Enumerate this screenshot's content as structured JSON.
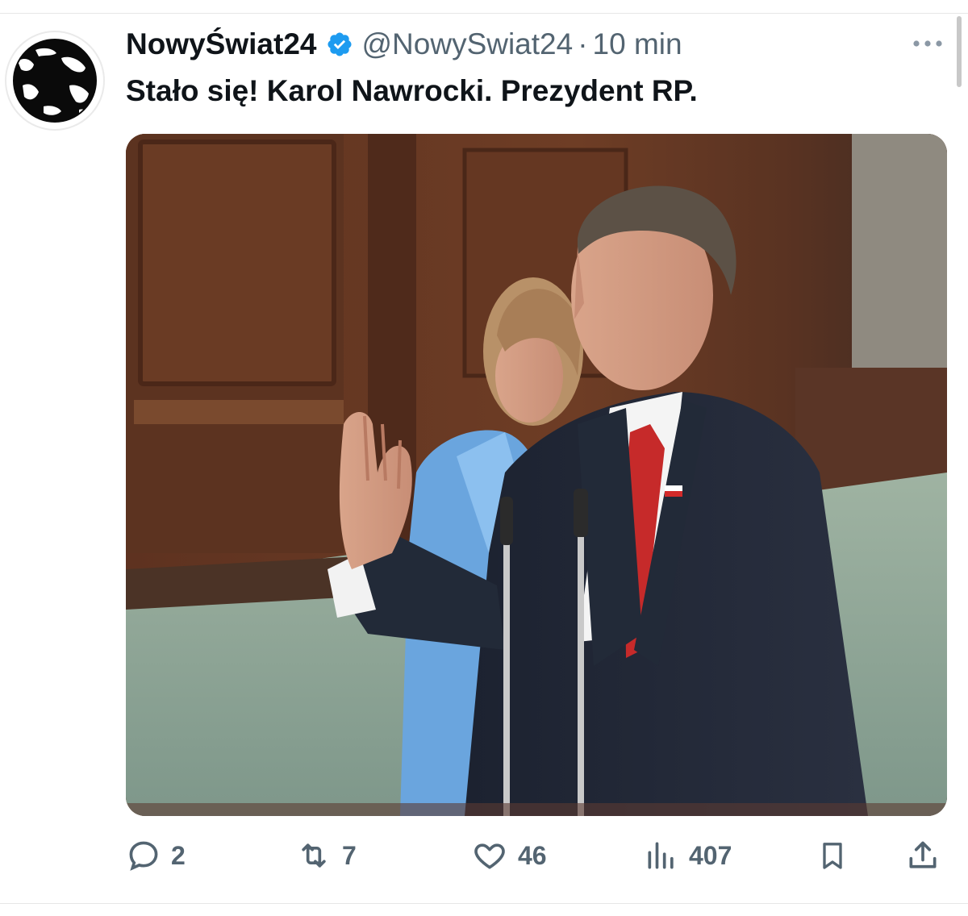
{
  "tweet": {
    "author": {
      "display_name": "NowyŚwiat24",
      "handle": "@NowySwiat24",
      "verified": true,
      "avatar_icon": "globe-icon"
    },
    "separator": "·",
    "time": "10 min",
    "text": "Stało się! Karol Nawrocki. Prezydent RP.",
    "media": {
      "kind": "photo",
      "subject": "swearing-in photo"
    },
    "actions": {
      "replies": "2",
      "reposts": "7",
      "likes": "46",
      "views": "407"
    }
  },
  "icons": {
    "more": "more-icon",
    "reply": "reply-icon",
    "repost": "repost-icon",
    "like": "heart-icon",
    "views": "views-icon",
    "bookmark": "bookmark-icon",
    "share": "share-icon"
  },
  "colors": {
    "verified_badge": "#1d9bf0",
    "secondary_text": "#536471",
    "primary_text": "#0f1419"
  }
}
